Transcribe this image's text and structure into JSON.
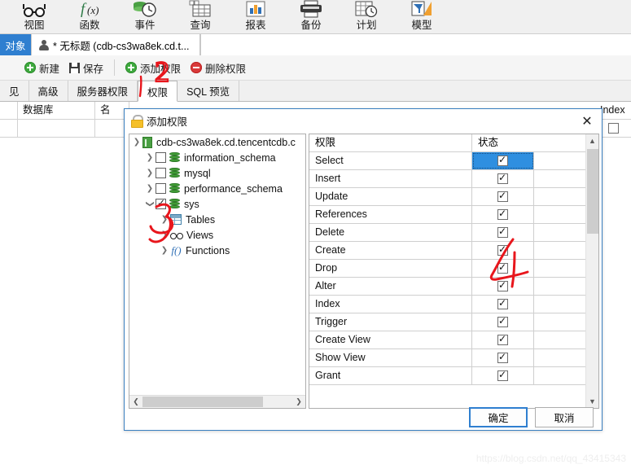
{
  "ribbon": {
    "items": [
      {
        "label": "视图",
        "icon": "glasses-icon"
      },
      {
        "label": "函数",
        "icon": "function-icon"
      },
      {
        "label": "事件",
        "icon": "event-clock-icon"
      },
      {
        "label": "查询",
        "icon": "query-grid-icon"
      },
      {
        "label": "报表",
        "icon": "report-chart-icon"
      },
      {
        "label": "备份",
        "icon": "backup-printer-icon"
      },
      {
        "label": "计划",
        "icon": "schedule-calendar-icon"
      },
      {
        "label": "模型",
        "icon": "model-icon"
      }
    ]
  },
  "tabstrip": {
    "object_tab": "对象",
    "document_tab": "* 无标题 (cdb-cs3wa8ek.cd.t..."
  },
  "toolbar": {
    "new_label": "新建",
    "save_label": "保存",
    "add_privilege_label": "添加权限",
    "delete_privilege_label": "删除权限"
  },
  "subtabs": {
    "items": [
      {
        "label": "见",
        "active": false
      },
      {
        "label": "高级",
        "active": false
      },
      {
        "label": "服务器权限",
        "active": false
      },
      {
        "label": "权限",
        "active": true
      },
      {
        "label": "SQL 预览",
        "active": false
      }
    ]
  },
  "background_grid": {
    "columns": [
      "数据库",
      "名",
      "Index"
    ],
    "rows": [
      {
        "数据库": "",
        "名": "",
        "Index": ""
      }
    ]
  },
  "dialog": {
    "title": "添加权限",
    "close_label": "✕",
    "tree": {
      "root": {
        "label": "cdb-cs3wa8ek.cd.tencentcdb.c",
        "icon": "server-icon",
        "expanded": true
      },
      "children": [
        {
          "label": "information_schema",
          "icon": "database-icon",
          "checked": false,
          "expanded": false,
          "indent": 1
        },
        {
          "label": "mysql",
          "icon": "database-icon",
          "checked": false,
          "expanded": false,
          "indent": 1
        },
        {
          "label": "performance_schema",
          "icon": "database-icon",
          "checked": false,
          "expanded": false,
          "indent": 1
        },
        {
          "label": "sys",
          "icon": "database-icon",
          "checked": true,
          "expanded": true,
          "indent": 1
        },
        {
          "label": "Tables",
          "icon": "table-icon",
          "expanded": false,
          "indent": 2
        },
        {
          "label": "Views",
          "icon": "view-icon",
          "expanded": false,
          "indent": 2
        },
        {
          "label": "Functions",
          "icon": "function-icon",
          "expanded": false,
          "indent": 2
        }
      ]
    },
    "permissions": {
      "headers": [
        "权限",
        "状态"
      ],
      "rows": [
        {
          "name": "Select",
          "checked": true,
          "selected": true
        },
        {
          "name": "Insert",
          "checked": true,
          "selected": false
        },
        {
          "name": "Update",
          "checked": true,
          "selected": false
        },
        {
          "name": "References",
          "checked": true,
          "selected": false
        },
        {
          "name": "Delete",
          "checked": true,
          "selected": false
        },
        {
          "name": "Create",
          "checked": true,
          "selected": false
        },
        {
          "name": "Drop",
          "checked": true,
          "selected": false
        },
        {
          "name": "Alter",
          "checked": true,
          "selected": false
        },
        {
          "name": "Index",
          "checked": true,
          "selected": false
        },
        {
          "name": "Trigger",
          "checked": true,
          "selected": false
        },
        {
          "name": "Create View",
          "checked": true,
          "selected": false
        },
        {
          "name": "Show View",
          "checked": true,
          "selected": false
        },
        {
          "name": "Grant",
          "checked": true,
          "selected": false
        }
      ]
    },
    "ok_label": "确定",
    "cancel_label": "取消"
  },
  "annotations": [
    {
      "text": "2",
      "color": "#e8161c"
    },
    {
      "text": "3",
      "color": "#e8161c"
    },
    {
      "text": "4",
      "color": "#e8161c"
    }
  ],
  "watermark": "https://blog.csdn.net/qq_43415343",
  "colors": {
    "accent": "#2f7fd0",
    "selection": "#2f8fe0",
    "annotation": "#e8161c",
    "db_green": "#3f9c35"
  }
}
